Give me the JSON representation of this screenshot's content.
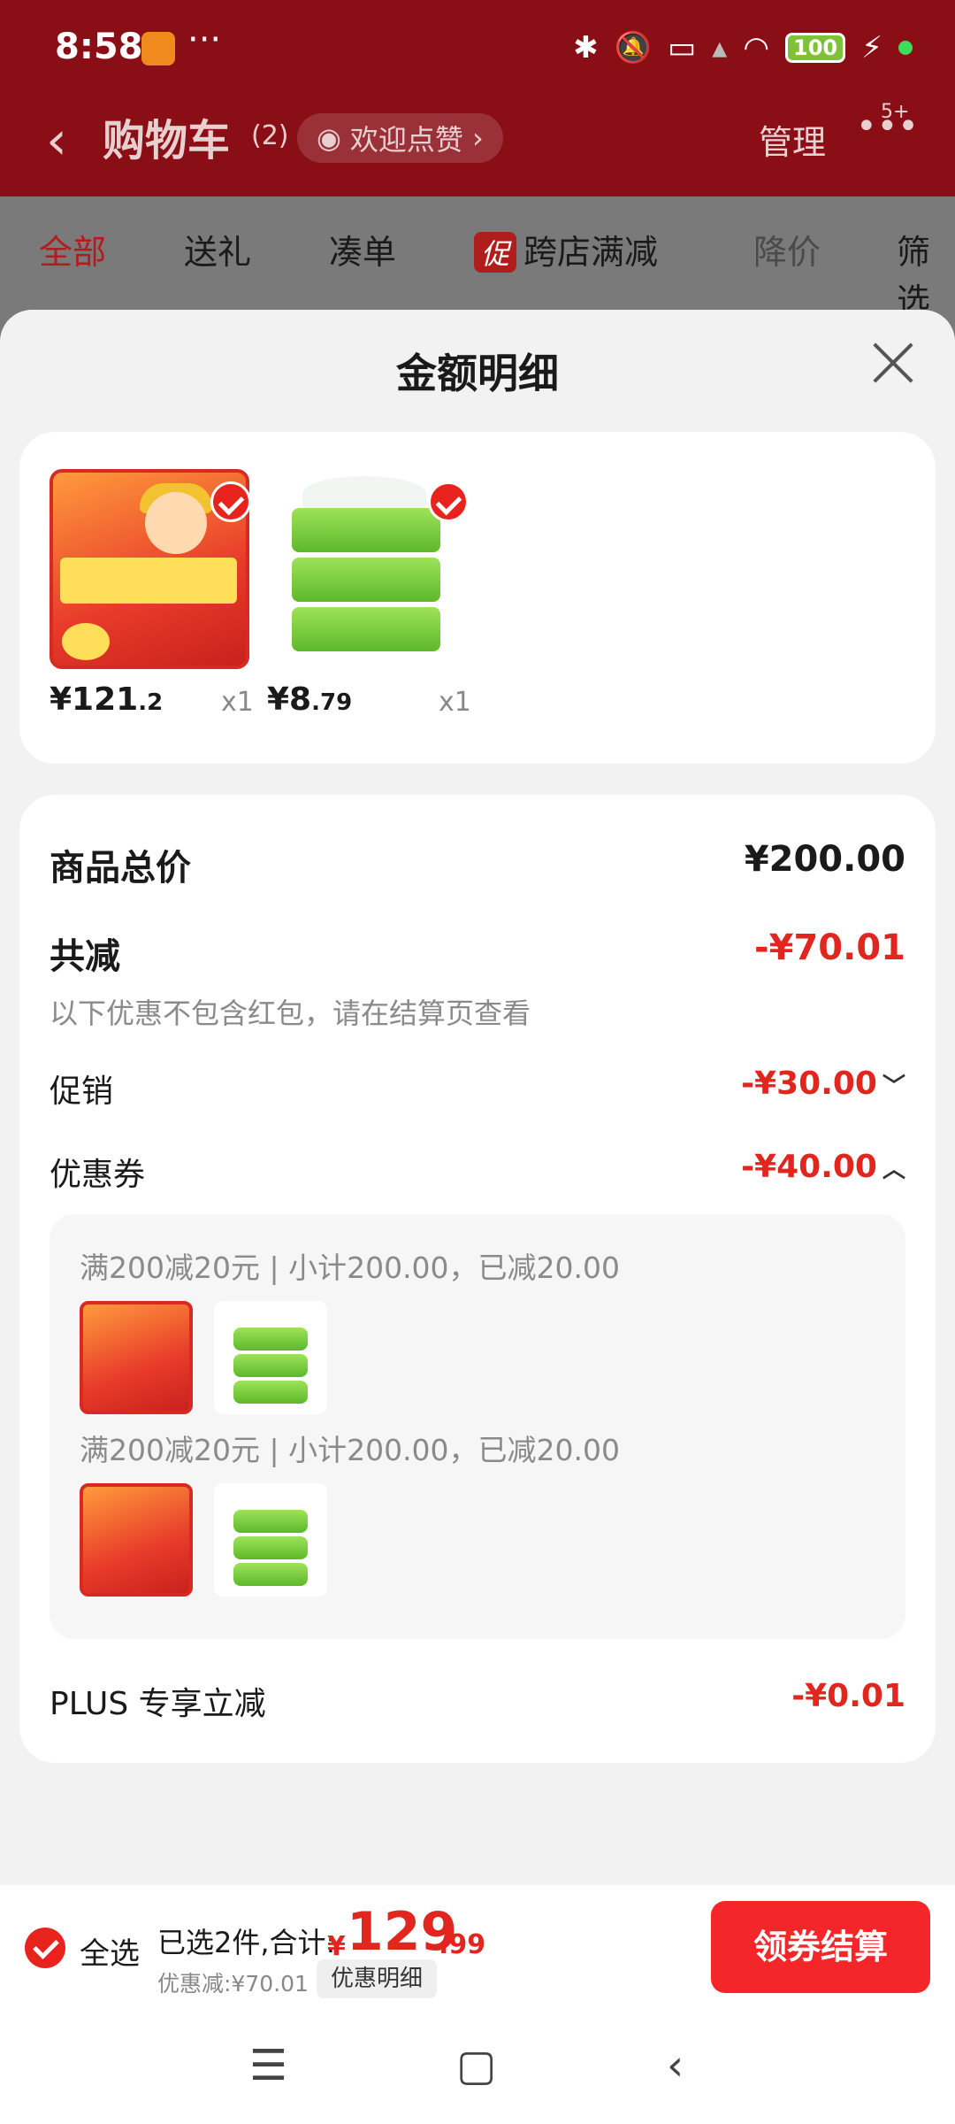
{
  "status_bar": {
    "time": "8:58",
    "more": "···",
    "battery": "100"
  },
  "header": {
    "title": "购物车",
    "count": "(2)",
    "like_label": "欢迎点赞",
    "manage_label": "管理",
    "more_badge": "5+"
  },
  "filters": [
    {
      "label": "全部"
    },
    {
      "label": "送礼"
    },
    {
      "label": "凑单"
    },
    {
      "tag": "促",
      "label": "跨店满减"
    },
    {
      "label": "降价"
    },
    {
      "label": "筛选"
    }
  ],
  "sheet": {
    "title": "金额明细",
    "products": [
      {
        "price_int": "¥121",
        "price_dec": ".2",
        "qty": "x1"
      },
      {
        "price_int": "¥8",
        "price_dec": ".79",
        "qty": "x1"
      }
    ],
    "total_label": "商品总价",
    "total_value": "¥200.00",
    "discount_label": "共减",
    "discount_value": "-¥70.01",
    "discount_note": "以下优惠不包含红包，请在结算页查看",
    "promo_label": "促销",
    "promo_value": "-¥30.00",
    "coupon_label": "优惠券",
    "coupon_value": "-¥40.00",
    "coupon_lines": [
      "满200减20元 | 小计200.00，已减20.00",
      "满200减20元 | 小计200.00，已减20.00"
    ],
    "plus_label": "PLUS 专享立减",
    "plus_value": "-¥0.01"
  },
  "bottom_bar": {
    "select_all": "全选",
    "summary": "已选2件,合计:",
    "currency": "¥",
    "total_int": "129",
    "total_dec": ".99",
    "discount": "优惠减:¥70.01",
    "detail_button": "优惠明细",
    "checkout_button": "领券结算"
  },
  "colors": {
    "accent": "#e0261e",
    "header_bg": "#8a0e16",
    "checkout": "#f5262a"
  },
  "icons": [
    "back-icon",
    "eye-icon",
    "more-icon",
    "close-icon",
    "check-icon",
    "chevron-down-icon",
    "chevron-up-icon",
    "menu-icon",
    "home-icon",
    "back-nav-icon"
  ]
}
